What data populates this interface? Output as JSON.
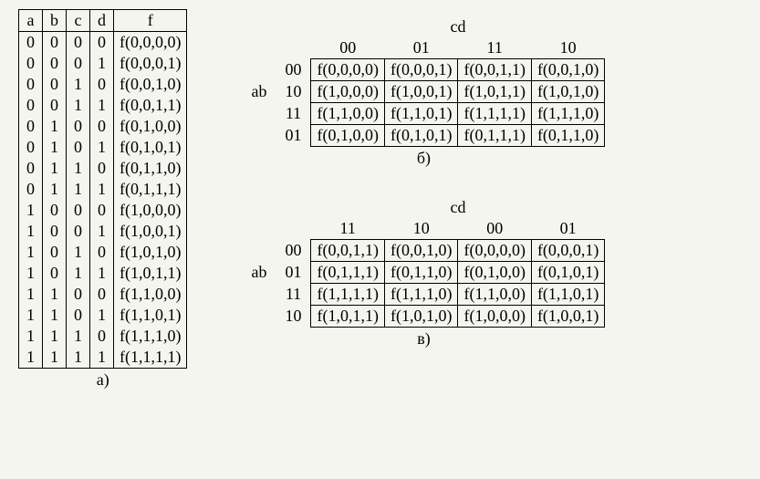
{
  "truth_table": {
    "headers": [
      "a",
      "b",
      "c",
      "d",
      "f"
    ],
    "rows": [
      [
        "0",
        "0",
        "0",
        "0",
        "f(0,0,0,0)"
      ],
      [
        "0",
        "0",
        "0",
        "1",
        "f(0,0,0,1)"
      ],
      [
        "0",
        "0",
        "1",
        "0",
        "f(0,0,1,0)"
      ],
      [
        "0",
        "0",
        "1",
        "1",
        "f(0,0,1,1)"
      ],
      [
        "0",
        "1",
        "0",
        "0",
        "f(0,1,0,0)"
      ],
      [
        "0",
        "1",
        "0",
        "1",
        "f(0,1,0,1)"
      ],
      [
        "0",
        "1",
        "1",
        "0",
        "f(0,1,1,0)"
      ],
      [
        "0",
        "1",
        "1",
        "1",
        "f(0,1,1,1)"
      ],
      [
        "1",
        "0",
        "0",
        "0",
        "f(1,0,0,0)"
      ],
      [
        "1",
        "0",
        "0",
        "1",
        "f(1,0,0,1)"
      ],
      [
        "1",
        "0",
        "1",
        "0",
        "f(1,0,1,0)"
      ],
      [
        "1",
        "0",
        "1",
        "1",
        "f(1,0,1,1)"
      ],
      [
        "1",
        "1",
        "0",
        "0",
        "f(1,1,0,0)"
      ],
      [
        "1",
        "1",
        "0",
        "1",
        "f(1,1,0,1)"
      ],
      [
        "1",
        "1",
        "1",
        "0",
        "f(1,1,1,0)"
      ],
      [
        "1",
        "1",
        "1",
        "1",
        "f(1,1,1,1)"
      ]
    ],
    "caption": "а)"
  },
  "kmap_b": {
    "ab_label": "ab",
    "cd_label": "cd",
    "col_headers": [
      "00",
      "01",
      "11",
      "10"
    ],
    "row_headers": [
      "00",
      "10",
      "11",
      "01"
    ],
    "cells": [
      [
        "f(0,0,0,0)",
        "f(0,0,0,1)",
        "f(0,0,1,1)",
        "f(0,0,1,0)"
      ],
      [
        "f(1,0,0,0)",
        "f(1,0,0,1)",
        "f(1,0,1,1)",
        "f(1,0,1,0)"
      ],
      [
        "f(1,1,0,0)",
        "f(1,1,0,1)",
        "f(1,1,1,1)",
        "f(1,1,1,0)"
      ],
      [
        "f(0,1,0,0)",
        "f(0,1,0,1)",
        "f(0,1,1,1)",
        "f(0,1,1,0)"
      ]
    ],
    "caption": "б)"
  },
  "kmap_v": {
    "ab_label": "ab",
    "cd_label": "cd",
    "col_headers": [
      "11",
      "10",
      "00",
      "01"
    ],
    "row_headers": [
      "00",
      "01",
      "11",
      "10"
    ],
    "cells": [
      [
        "f(0,0,1,1)",
        "f(0,0,1,0)",
        "f(0,0,0,0)",
        "f(0,0,0,1)"
      ],
      [
        "f(0,1,1,1)",
        "f(0,1,1,0)",
        "f(0,1,0,0)",
        "f(0,1,0,1)"
      ],
      [
        "f(1,1,1,1)",
        "f(1,1,1,0)",
        "f(1,1,0,0)",
        "f(1,1,0,1)"
      ],
      [
        "f(1,0,1,1)",
        "f(1,0,1,0)",
        "f(1,0,0,0)",
        "f(1,0,0,1)"
      ]
    ],
    "caption": "в)"
  }
}
